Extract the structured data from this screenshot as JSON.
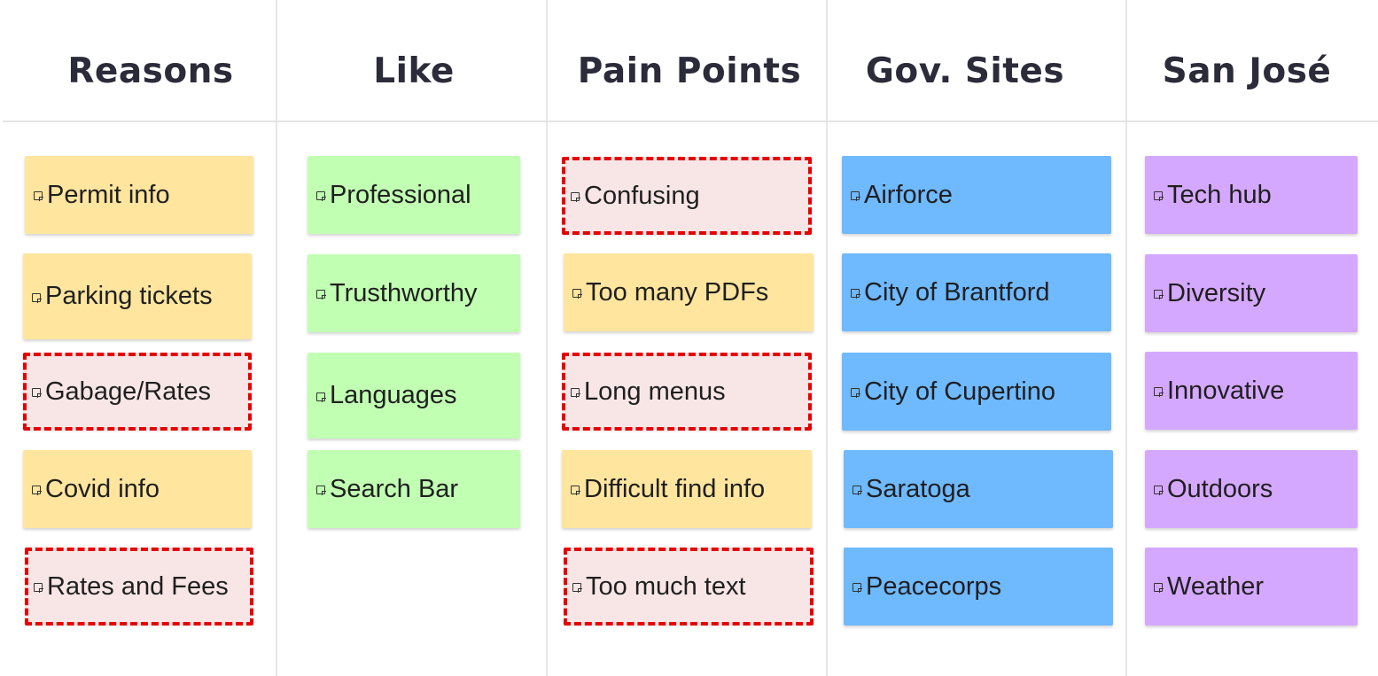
{
  "columns": [
    {
      "title": "Reasons",
      "notes": [
        {
          "text": "Permit info",
          "color": "#ffe59e",
          "highlighted": false
        },
        {
          "text": "Parking tickets",
          "color": "#ffe59e",
          "highlighted": false
        },
        {
          "text": "Gabage/Rates",
          "color": "#f8e6e6",
          "highlighted": true
        },
        {
          "text": "Covid info",
          "color": "#ffe59e",
          "highlighted": false
        },
        {
          "text": "Rates and Fees",
          "color": "#f8e6e6",
          "highlighted": true
        }
      ]
    },
    {
      "title": "Like",
      "notes": [
        {
          "text": "Professional",
          "color": "#c1ffb3",
          "highlighted": false
        },
        {
          "text": "Trusthworthy",
          "color": "#c1ffb3",
          "highlighted": false
        },
        {
          "text": "Languages",
          "color": "#c1ffb3",
          "highlighted": false
        },
        {
          "text": "Search Bar",
          "color": "#c1ffb3",
          "highlighted": false
        }
      ]
    },
    {
      "title": "Pain Points",
      "notes": [
        {
          "text": "Confusing",
          "color": "#f8e6e6",
          "highlighted": true
        },
        {
          "text": "Too many PDFs",
          "color": "#ffe59e",
          "highlighted": false
        },
        {
          "text": "Long menus",
          "color": "#f8e6e6",
          "highlighted": true
        },
        {
          "text": "Difficult find info",
          "color": "#ffe59e",
          "highlighted": false
        },
        {
          "text": "Too much text",
          "color": "#f8e6e6",
          "highlighted": true
        }
      ]
    },
    {
      "title": "Gov. Sites",
      "notes": [
        {
          "text": "Airforce",
          "color": "#6fb9ff",
          "highlighted": false
        },
        {
          "text": "City of Brantford",
          "color": "#6fb9ff",
          "highlighted": false
        },
        {
          "text": "City of Cupertino",
          "color": "#6fb9ff",
          "highlighted": false
        },
        {
          "text": "Saratoga",
          "color": "#6fb9ff",
          "highlighted": false
        },
        {
          "text": "Peacecorps",
          "color": "#6fb9ff",
          "highlighted": false
        }
      ]
    },
    {
      "title": "San José",
      "notes": [
        {
          "text": "Tech hub",
          "color": "#d5a8ff",
          "highlighted": false
        },
        {
          "text": "Diversity",
          "color": "#d5a8ff",
          "highlighted": false
        },
        {
          "text": "Innovative",
          "color": "#d5a8ff",
          "highlighted": false
        },
        {
          "text": "Outdoors",
          "color": "#d5a8ff",
          "highlighted": false
        },
        {
          "text": "Weather",
          "color": "#d5a8ff",
          "highlighted": false
        }
      ]
    }
  ],
  "icons": {
    "note": "sticky-note-icon"
  },
  "colors": {
    "highlight_border": "#e60000",
    "title_text": "#2b2b3a",
    "divider": "#e6e6e6"
  }
}
